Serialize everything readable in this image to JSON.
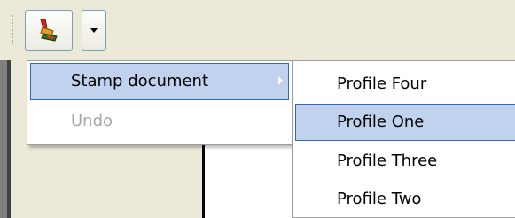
{
  "toolbar": {
    "stamp_icon": "stamp-icon",
    "dropdown_icon": "chevron-down-icon"
  },
  "menu": {
    "items": [
      {
        "label": "Stamp document",
        "state": "highlighted",
        "has_submenu": true
      },
      {
        "label": "Undo",
        "state": "disabled"
      }
    ]
  },
  "submenu": {
    "items": [
      {
        "label": "Profile Four"
      },
      {
        "label": "Profile One",
        "state": "highlighted"
      },
      {
        "label": "Profile Three"
      },
      {
        "label": "Profile Two"
      }
    ]
  },
  "colors": {
    "highlight_fill": "#c1d2ee",
    "highlight_border": "#316ac5",
    "disabled_text": "#a7a6aa",
    "toolbar_bg": "#ece9d8"
  }
}
